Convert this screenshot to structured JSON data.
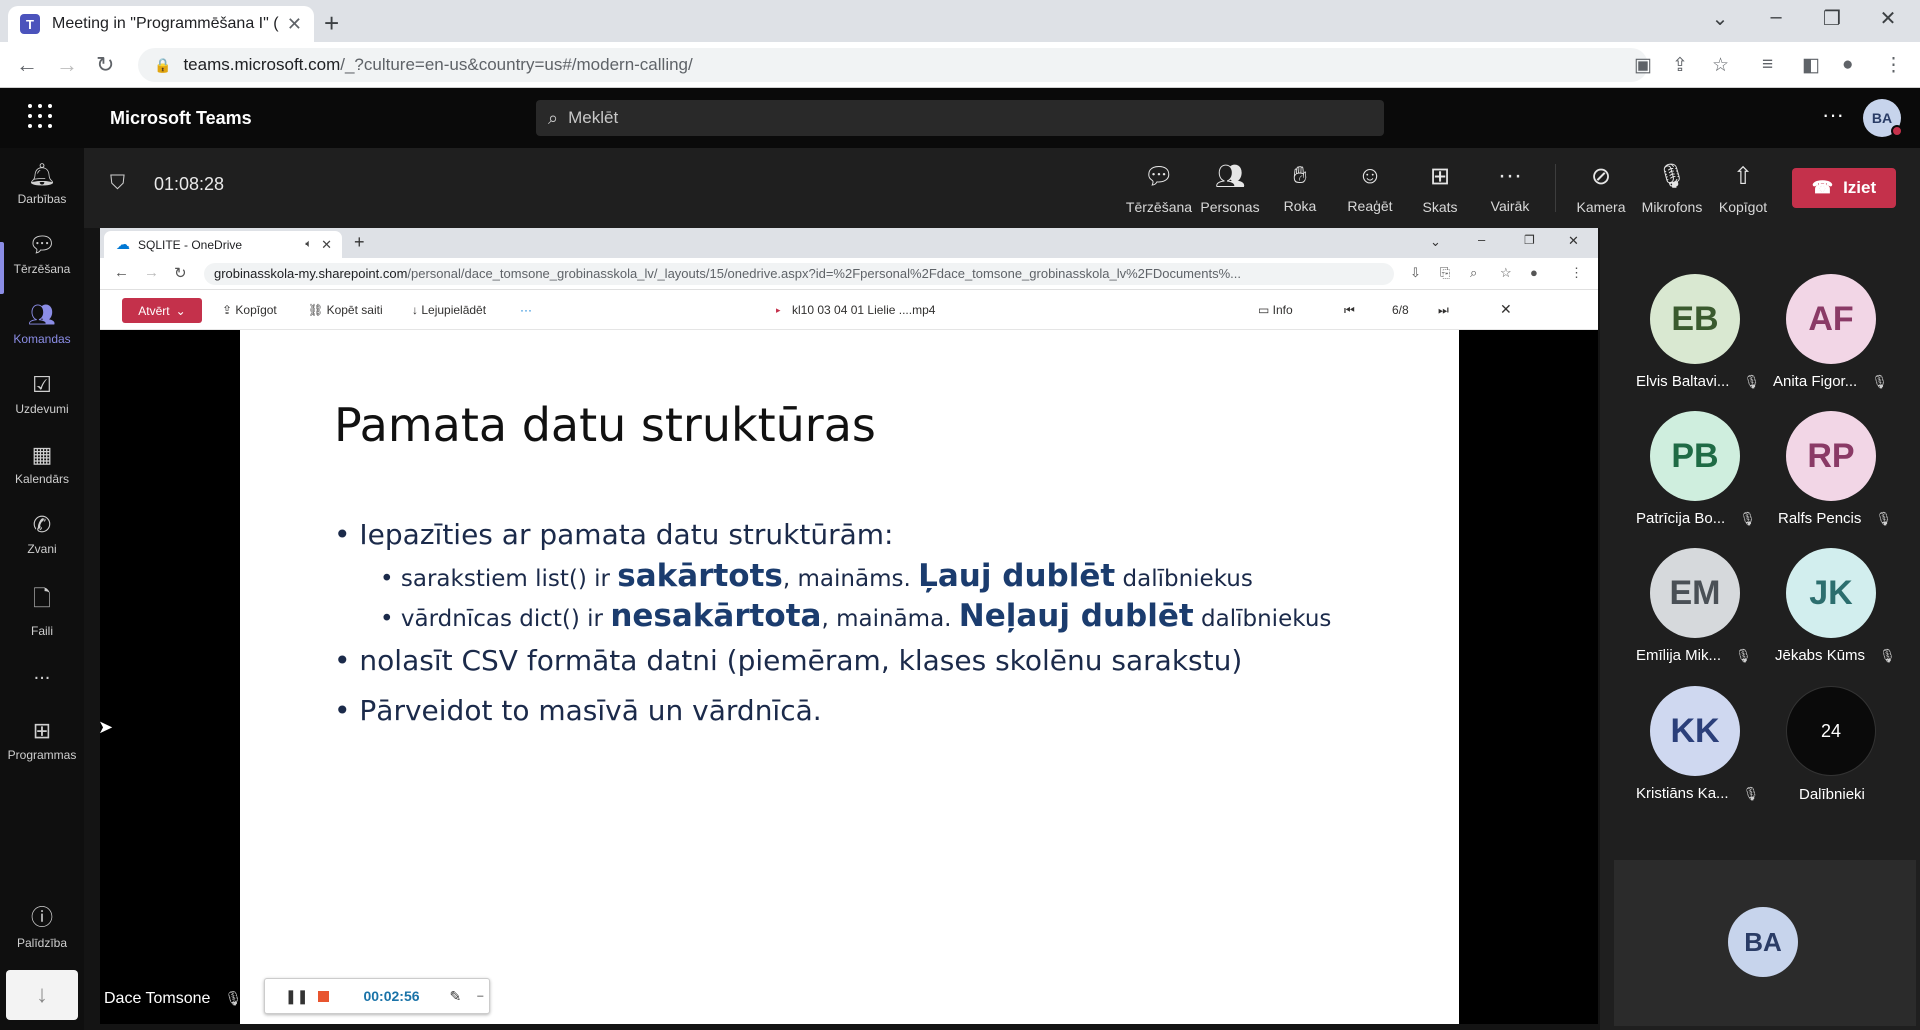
{
  "browser": {
    "tab_title": "Meeting in \"Programmēšana I\" (S",
    "url_host": "teams.microsoft.com",
    "url_path": "/_?culture=en-us&country=us#/modern-calling/"
  },
  "teams": {
    "app_name": "Microsoft Teams",
    "search_placeholder": "Meklēt",
    "user_initials": "BA"
  },
  "rail": {
    "items": [
      {
        "label": "Darbības",
        "icon": "bell-icon"
      },
      {
        "label": "Tērzēšana",
        "icon": "chat-icon"
      },
      {
        "label": "Komandas",
        "icon": "teams-icon"
      },
      {
        "label": "Uzdevumi",
        "icon": "tasks-icon"
      },
      {
        "label": "Kalendārs",
        "icon": "calendar-icon"
      },
      {
        "label": "Zvani",
        "icon": "phone-icon"
      },
      {
        "label": "Faili",
        "icon": "file-icon"
      },
      {
        "label": "...",
        "icon": "more-icon"
      },
      {
        "label": "Programmas",
        "icon": "apps-icon"
      },
      {
        "label": "Palīdzība",
        "icon": "help-icon"
      }
    ]
  },
  "meeting": {
    "timer": "01:08:28",
    "controls": [
      {
        "label": "Tērzēšana",
        "icon": "chat-icon"
      },
      {
        "label": "Personas",
        "icon": "people-icon"
      },
      {
        "label": "Roka",
        "icon": "hand-icon"
      },
      {
        "label": "Reaģēt",
        "icon": "smile-icon"
      },
      {
        "label": "Skats",
        "icon": "grid-icon"
      },
      {
        "label": "Vairāk",
        "icon": "more-icon"
      },
      {
        "label": "Kamera",
        "icon": "camera-off-icon"
      },
      {
        "label": "Mikrofons",
        "icon": "mic-off-icon"
      },
      {
        "label": "Kopīgot",
        "icon": "share-icon"
      }
    ],
    "leave_label": "Iziet",
    "leave_color": "#c4314b"
  },
  "shared": {
    "tab_title": "SQLITE - OneDrive",
    "url_host": "grobinasskola-my.sharepoint.com",
    "url_path": "/personal/dace_tomsone_grobinasskola_lv/_layouts/15/onedrive.aspx?id=%2Fpersonal%2Fdace_tomsone_grobinasskola_lv%2FDocuments%...",
    "open_label": "Atvērt",
    "toolbar": {
      "copy": "Kopīgot",
      "copy_link": "Kopēt saiti",
      "download": "Lejupielādēt",
      "more": "···"
    },
    "file_name": "kl10 03 04 01 Lielie ....mp4",
    "info": "Info",
    "page": "6/8",
    "slide": {
      "title": "Pamata datu struktūras",
      "bullet1": "Iepazīties ar pamata datu struktūrām:",
      "sub1": {
        "pre": "sarakstiem list() ir ",
        "bold1": "sakārtots",
        "mid": ", maināms. ",
        "bold2": "Ļauj dublēt",
        "post": " dalībniekus"
      },
      "sub2": {
        "pre": "vārdnīcas dict() ir ",
        "bold1": "nesakārtota",
        "mid": ", maināma. ",
        "bold2": "Neļauj dublēt",
        "post": " dalībniekus"
      },
      "bullet2": "nolasīt CSV formāta datni (piemēram, klases skolēnu sarakstu)",
      "bullet3": "Pārveidot to masīvā un vārdnīcā."
    },
    "recording_time": "00:02:56",
    "presenter": "Dace Tomsone"
  },
  "participants": [
    {
      "initials": "EB",
      "name": "Elvis Baltavi...",
      "bg": "#d9e8d1",
      "fg": "#3a5a2e"
    },
    {
      "initials": "AF",
      "name": "Anita Figor...",
      "bg": "#f2d6e6",
      "fg": "#8a3a66"
    },
    {
      "initials": "PB",
      "name": "Patrīcija Bo...",
      "bg": "#cfeede",
      "fg": "#1f6b45"
    },
    {
      "initials": "RP",
      "name": "Ralfs Pencis",
      "bg": "#f2d6e6",
      "fg": "#8a3a66"
    },
    {
      "initials": "EM",
      "name": "Emīlija Mik...",
      "bg": "#d6d9dc",
      "fg": "#4a5056"
    },
    {
      "initials": "JK",
      "name": "Jēkabs Kūms",
      "bg": "#d2eeee",
      "fg": "#2c6e6e"
    },
    {
      "initials": "KK",
      "name": "Kristiāns Ka...",
      "bg": "#cfd8f0",
      "fg": "#2b3f7a"
    },
    {
      "initials": "24",
      "name": "Dalībnieki",
      "bg": "#0a0a0a",
      "fg": "#ffffff"
    }
  ],
  "self_initials": "BA"
}
